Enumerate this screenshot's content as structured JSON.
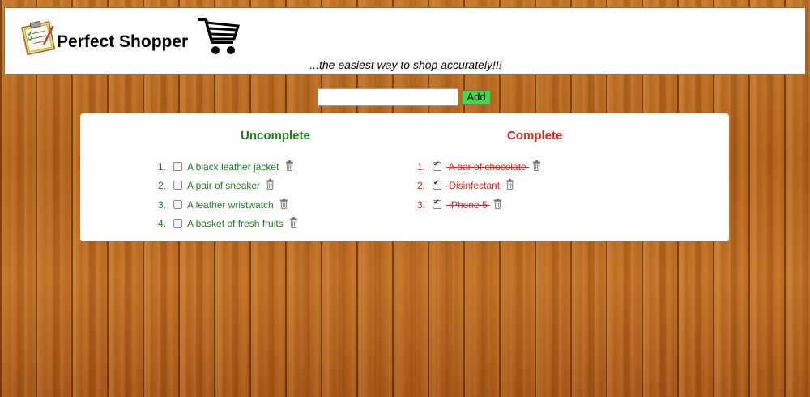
{
  "header": {
    "title": "Perfect Shopper",
    "tagline": "...the easiest way to shop accurately!!!",
    "logo_icon": "shopping-list-icon",
    "cart_icon": "shopping-cart-icon"
  },
  "add_form": {
    "input_value": "",
    "button_label": "Add",
    "button_color": "#3ddc4a"
  },
  "uncomplete": {
    "heading": "Uncomplete",
    "color": "#1f7a1f",
    "items": [
      {
        "number": "1.",
        "label": "A black leather jacket",
        "checked": false
      },
      {
        "number": "2.",
        "label": "A pair of sneaker",
        "checked": false
      },
      {
        "number": "3.",
        "label": "A leather wristwatch",
        "checked": false
      },
      {
        "number": "4.",
        "label": "A basket of fresh fruits",
        "checked": false
      }
    ]
  },
  "complete": {
    "heading": "Complete",
    "color": "#e02020",
    "items": [
      {
        "number": "1.",
        "label": " A bar of chocolate ",
        "checked": true
      },
      {
        "number": "2.",
        "label": " Disinfectant ",
        "checked": true
      },
      {
        "number": "3.",
        "label": " iPhone 5 ",
        "checked": true
      }
    ]
  }
}
